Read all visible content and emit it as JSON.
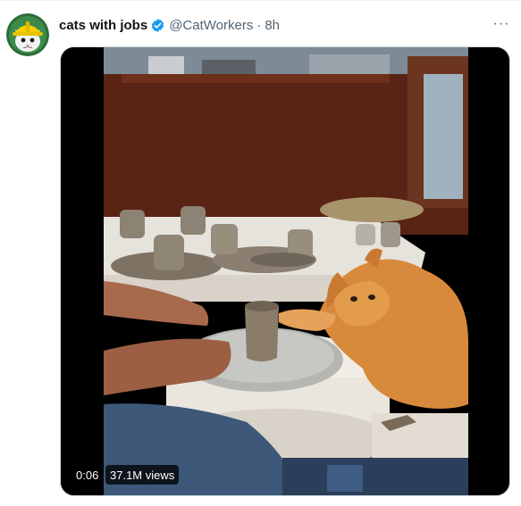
{
  "tweet": {
    "author_name": "cats with jobs",
    "handle": "@CatWorkers",
    "separator": "·",
    "time_ago": "8h",
    "more_label": "···",
    "verified_icon": "verified-badge-icon",
    "avatar_icon": "cat-in-hardhat-avatar"
  },
  "video": {
    "elapsed": "0:06",
    "views": "37.1M views",
    "content_icon": "cat-at-pottery-wheel-video"
  },
  "colors": {
    "text": "#0f1419",
    "secondary": "#536471",
    "verified": "#1d9bf0",
    "badge_bg": "#000000",
    "avatar_helmet": "#f5d000"
  }
}
